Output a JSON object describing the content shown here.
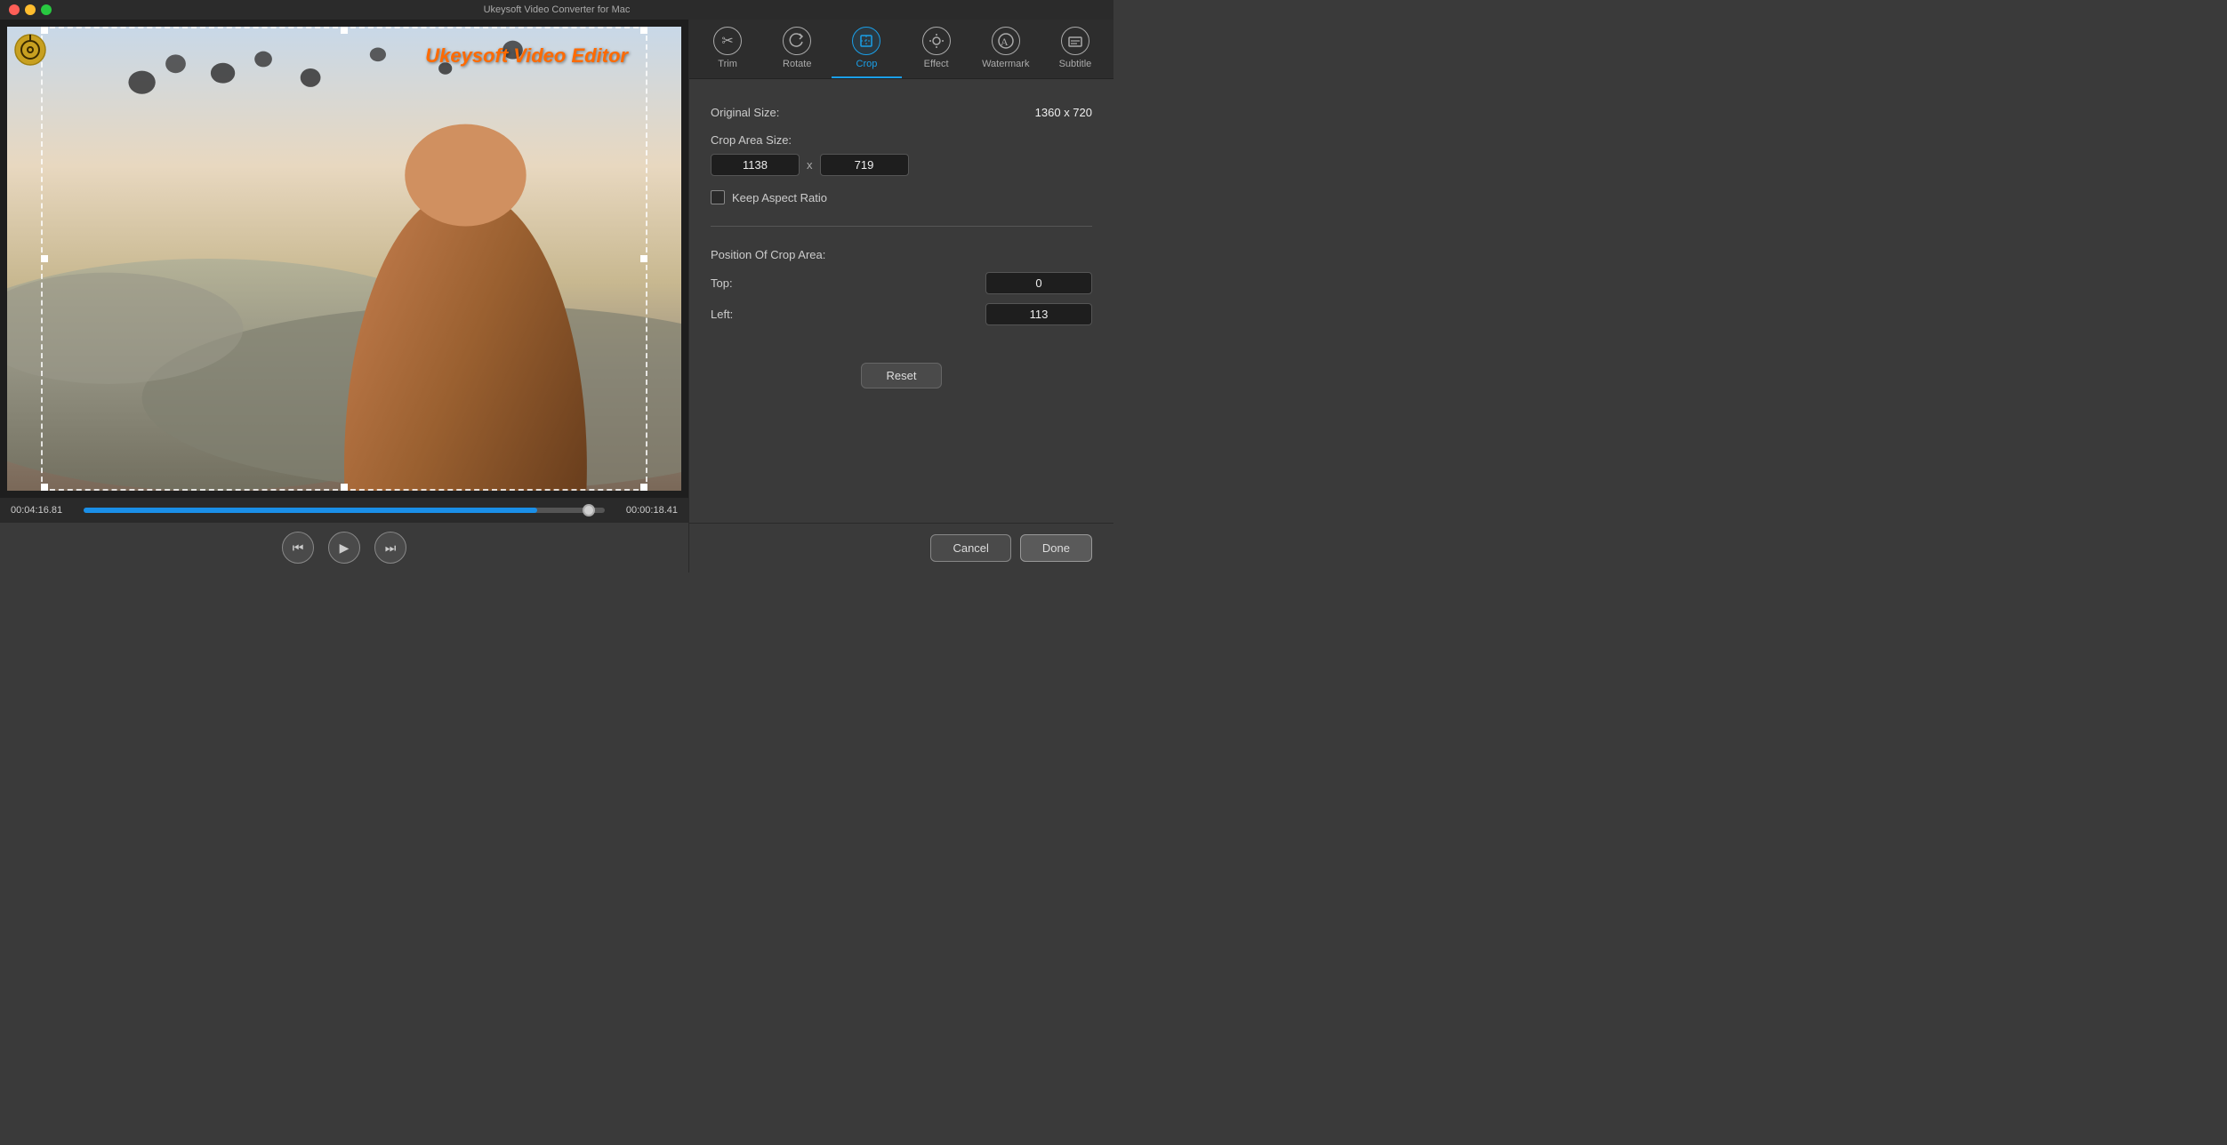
{
  "window": {
    "title": "Ukeysoft Video Converter for Mac"
  },
  "titlebar": {
    "buttons": [
      "close",
      "minimize",
      "maximize"
    ]
  },
  "video": {
    "title_overlay": "Ukeysoft Video Editor",
    "time_current": "00:04:16.81",
    "time_remaining": "00:00:18.41",
    "progress_percent": 87
  },
  "controls": {
    "prev_label": "⏮",
    "play_label": "▶",
    "next_label": "⏭"
  },
  "tabs": [
    {
      "id": "trim",
      "label": "Trim",
      "icon": "✂"
    },
    {
      "id": "rotate",
      "label": "Rotate",
      "icon": "↻"
    },
    {
      "id": "crop",
      "label": "Crop",
      "icon": "⬜",
      "active": true
    },
    {
      "id": "effect",
      "label": "Effect",
      "icon": "✦"
    },
    {
      "id": "watermark",
      "label": "Watermark",
      "icon": "Ⓐ"
    },
    {
      "id": "subtitle",
      "label": "Subtitle",
      "icon": "A"
    }
  ],
  "crop_panel": {
    "original_size_label": "Original Size:",
    "original_size_value": "1360 x 720",
    "crop_area_label": "Crop Area Size:",
    "crop_width": "1138",
    "crop_height": "719",
    "crop_x_separator": "x",
    "keep_aspect_label": "Keep Aspect Ratio",
    "position_title": "Position Of Crop Area:",
    "top_label": "Top:",
    "top_value": "0",
    "left_label": "Left:",
    "left_value": "113",
    "reset_label": "Reset"
  },
  "actions": {
    "cancel_label": "Cancel",
    "done_label": "Done"
  }
}
